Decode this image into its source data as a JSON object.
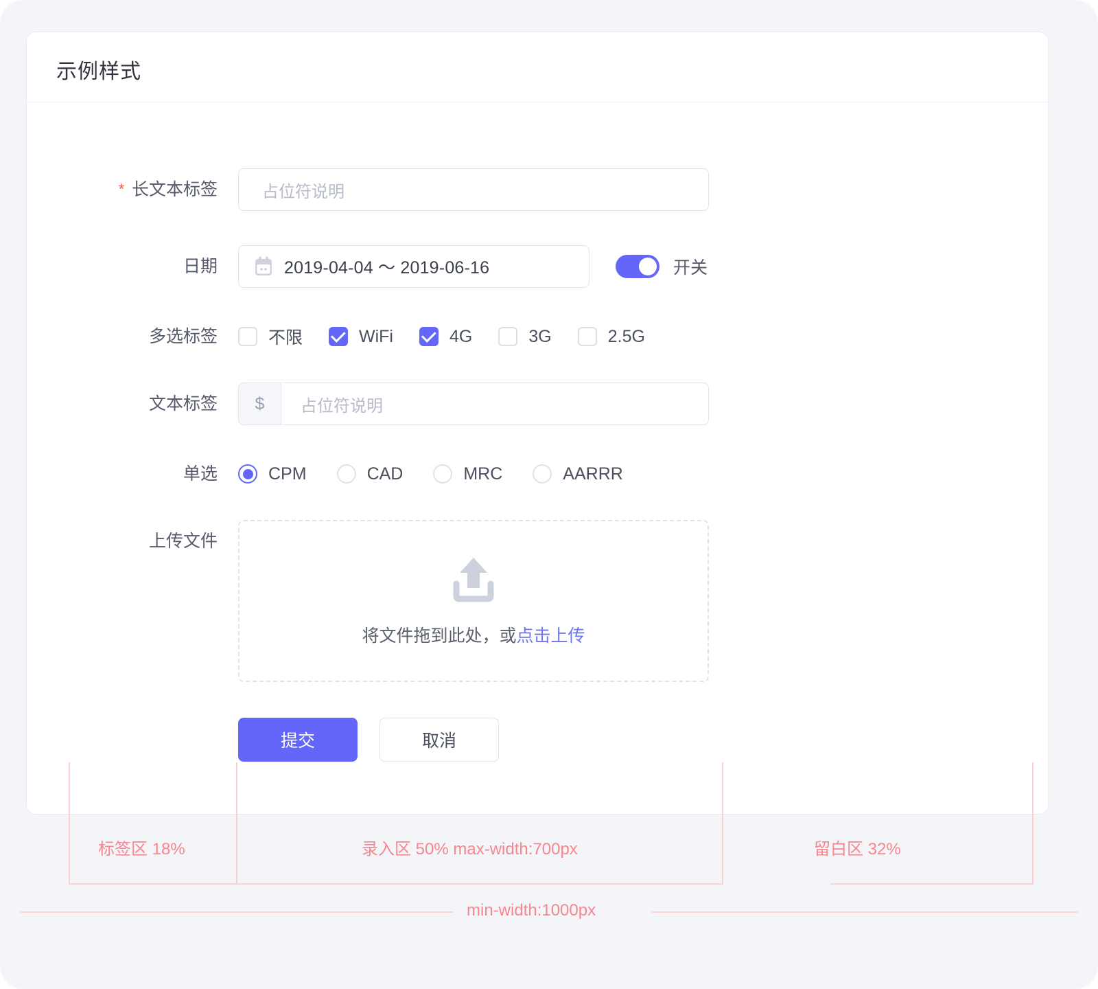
{
  "card": {
    "title": "示例样式"
  },
  "form": {
    "rows": [
      {
        "label": "长文本标签",
        "required": true,
        "placeholder": "占位符说明"
      },
      {
        "label": "日期",
        "icon": "calendar-icon",
        "value": "2019-04-04 ～ 2019-06-16",
        "switch": {
          "state": "on",
          "label": "开关"
        }
      },
      {
        "label": "多选标签",
        "checkboxes": [
          {
            "label": "不限",
            "checked": false
          },
          {
            "label": "WiFi",
            "checked": true
          },
          {
            "label": "4G",
            "checked": true
          },
          {
            "label": "3G",
            "checked": false
          },
          {
            "label": "2.5G",
            "checked": false
          }
        ]
      },
      {
        "label": "文本标签",
        "prefix": "$",
        "placeholder": "占位符说明"
      },
      {
        "label": "单选",
        "radios": [
          {
            "label": "CPM",
            "checked": true
          },
          {
            "label": "CAD",
            "checked": false
          },
          {
            "label": "MRC",
            "checked": false
          },
          {
            "label": "AARRR",
            "checked": false
          }
        ]
      },
      {
        "label": "上传文件",
        "upload": {
          "icon": "upload-icon",
          "text_before": "将文件拖到此处，或",
          "link": "点击上传"
        }
      }
    ],
    "actions": {
      "submit": "提交",
      "cancel": "取消"
    }
  },
  "annotations": {
    "label_zone": "标签区 18%",
    "input_zone": "录入区 50% max-width:700px",
    "blank_zone": "留白区 32%",
    "min_width": "min-width:1000px"
  },
  "colors": {
    "primary": "#6366f8",
    "required_asterisk": "#f5503c",
    "link": "#6b74f5",
    "annotation": "#f5878f",
    "annotation_line": "#fbd2d3",
    "page_bg": "#f4f5f9",
    "card_bg": "#ffffff",
    "border": "#e1e3ed"
  }
}
